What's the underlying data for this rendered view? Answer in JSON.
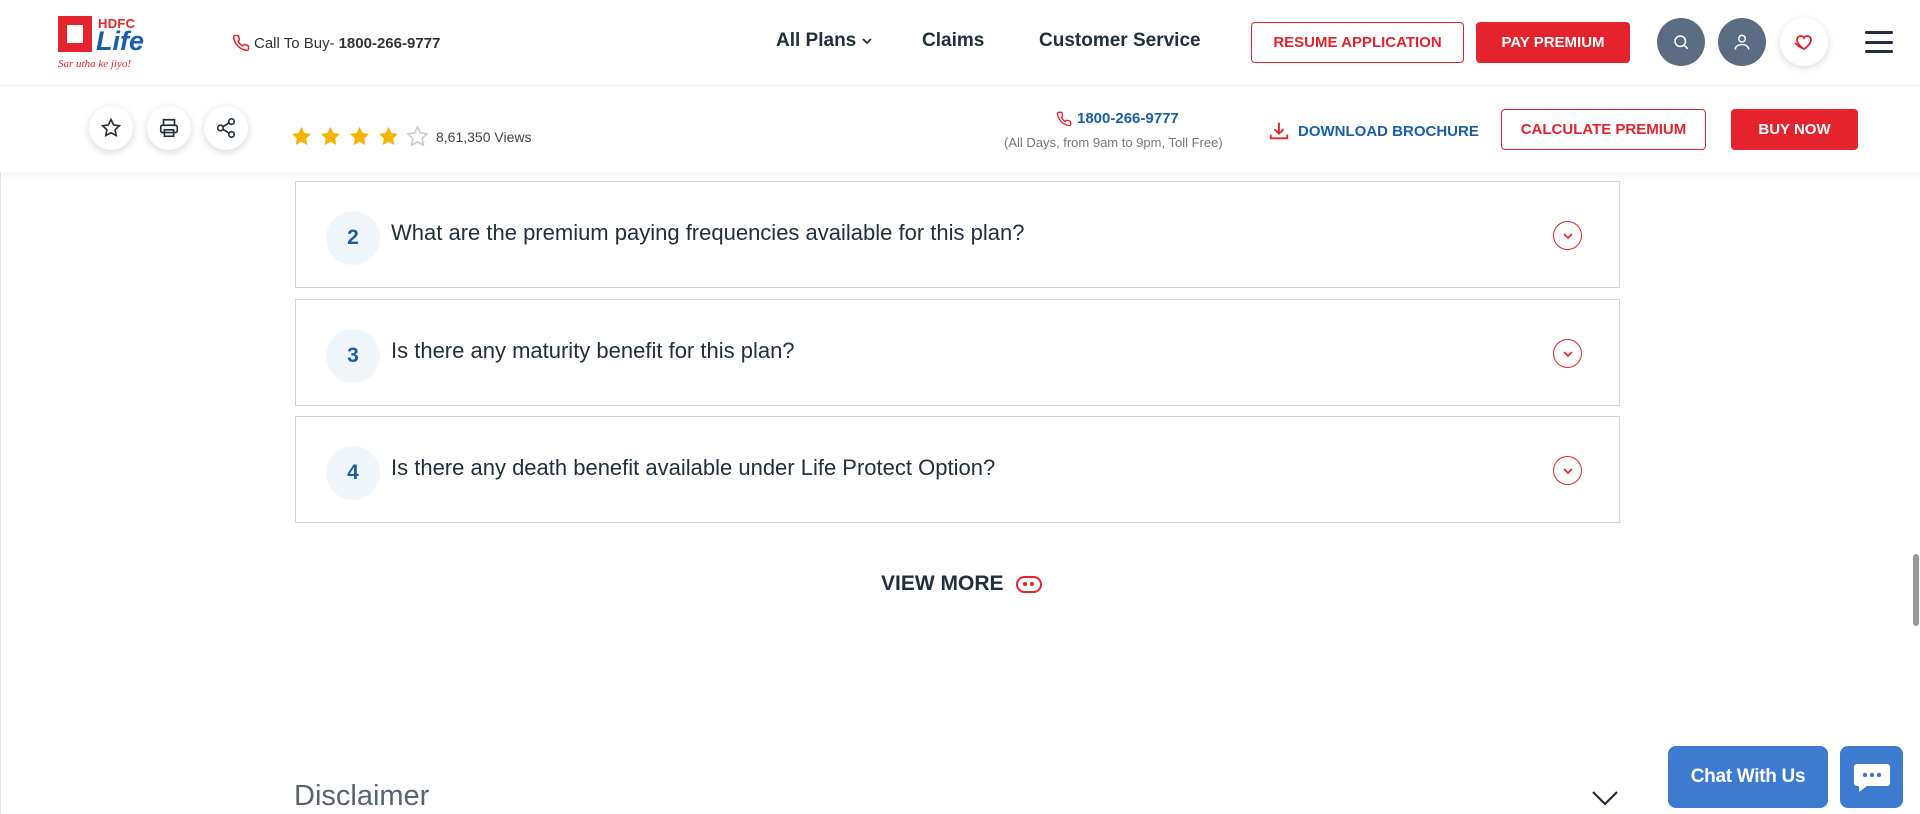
{
  "header": {
    "logo": {
      "brand": "HDFC",
      "name": "Life",
      "tagline": "Sar utha ke jiyo!"
    },
    "call_to_buy": {
      "label": "Call To Buy-",
      "number": "1800-266-9777"
    },
    "nav": [
      {
        "label": "All Plans"
      },
      {
        "label": "Claims"
      },
      {
        "label": "Customer Service"
      }
    ],
    "resume_label": "RESUME APPLICATION",
    "pay_label": "PAY PREMIUM"
  },
  "subbar": {
    "rating": 4,
    "rating_max": 5,
    "views": "8,61,350 Views",
    "phone": "1800-266-9777",
    "hours": "(All Days, from 9am to 9pm, Toll Free)",
    "download_label": "DOWNLOAD BROCHURE",
    "calculate_label": "CALCULATE PREMIUM",
    "buy_label": "BUY NOW"
  },
  "faqs": [
    {
      "num": "2",
      "question": "What are the premium paying frequencies available for this plan?"
    },
    {
      "num": "3",
      "question": "Is there any maturity benefit for this plan?"
    },
    {
      "num": "4",
      "question": "Is there any death benefit available under Life Protect Option?"
    }
  ],
  "view_more_label": "VIEW MORE",
  "disclaimer_title": "Disclaimer",
  "chat_label": "Chat With Us",
  "colors": {
    "brand_red": "#e5232d",
    "brand_blue": "#1a5ea8",
    "chat_blue": "#3d7bd0",
    "star_gold": "#f5b400"
  }
}
